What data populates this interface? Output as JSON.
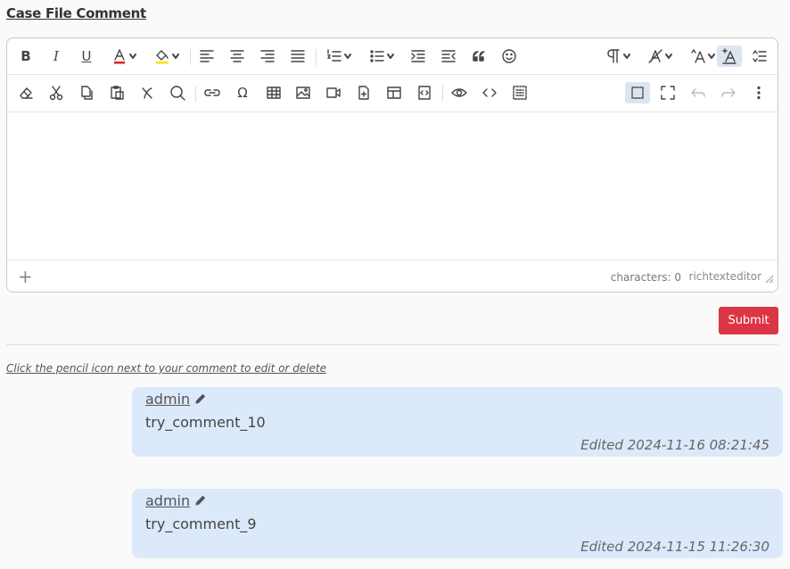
{
  "title": "Case File Comment",
  "editor": {
    "status_chars": "characters: 0",
    "status_brand": "richtexteditor"
  },
  "submit_label": "Submit",
  "hint": "Click the pencil icon next to your comment to edit or delete",
  "comments": [
    {
      "author": "admin",
      "text": "try_comment_10",
      "edited": "Edited 2024-11-16 08:21:45"
    },
    {
      "author": "admin",
      "text": "try_comment_9",
      "edited": "Edited 2024-11-15 11:26:30"
    }
  ],
  "colors": {
    "accent_red": "#dc3545",
    "comment_bg": "#dce9fb",
    "font_color_swatch": "#e02020",
    "bg_color_swatch": "#f5e600"
  }
}
